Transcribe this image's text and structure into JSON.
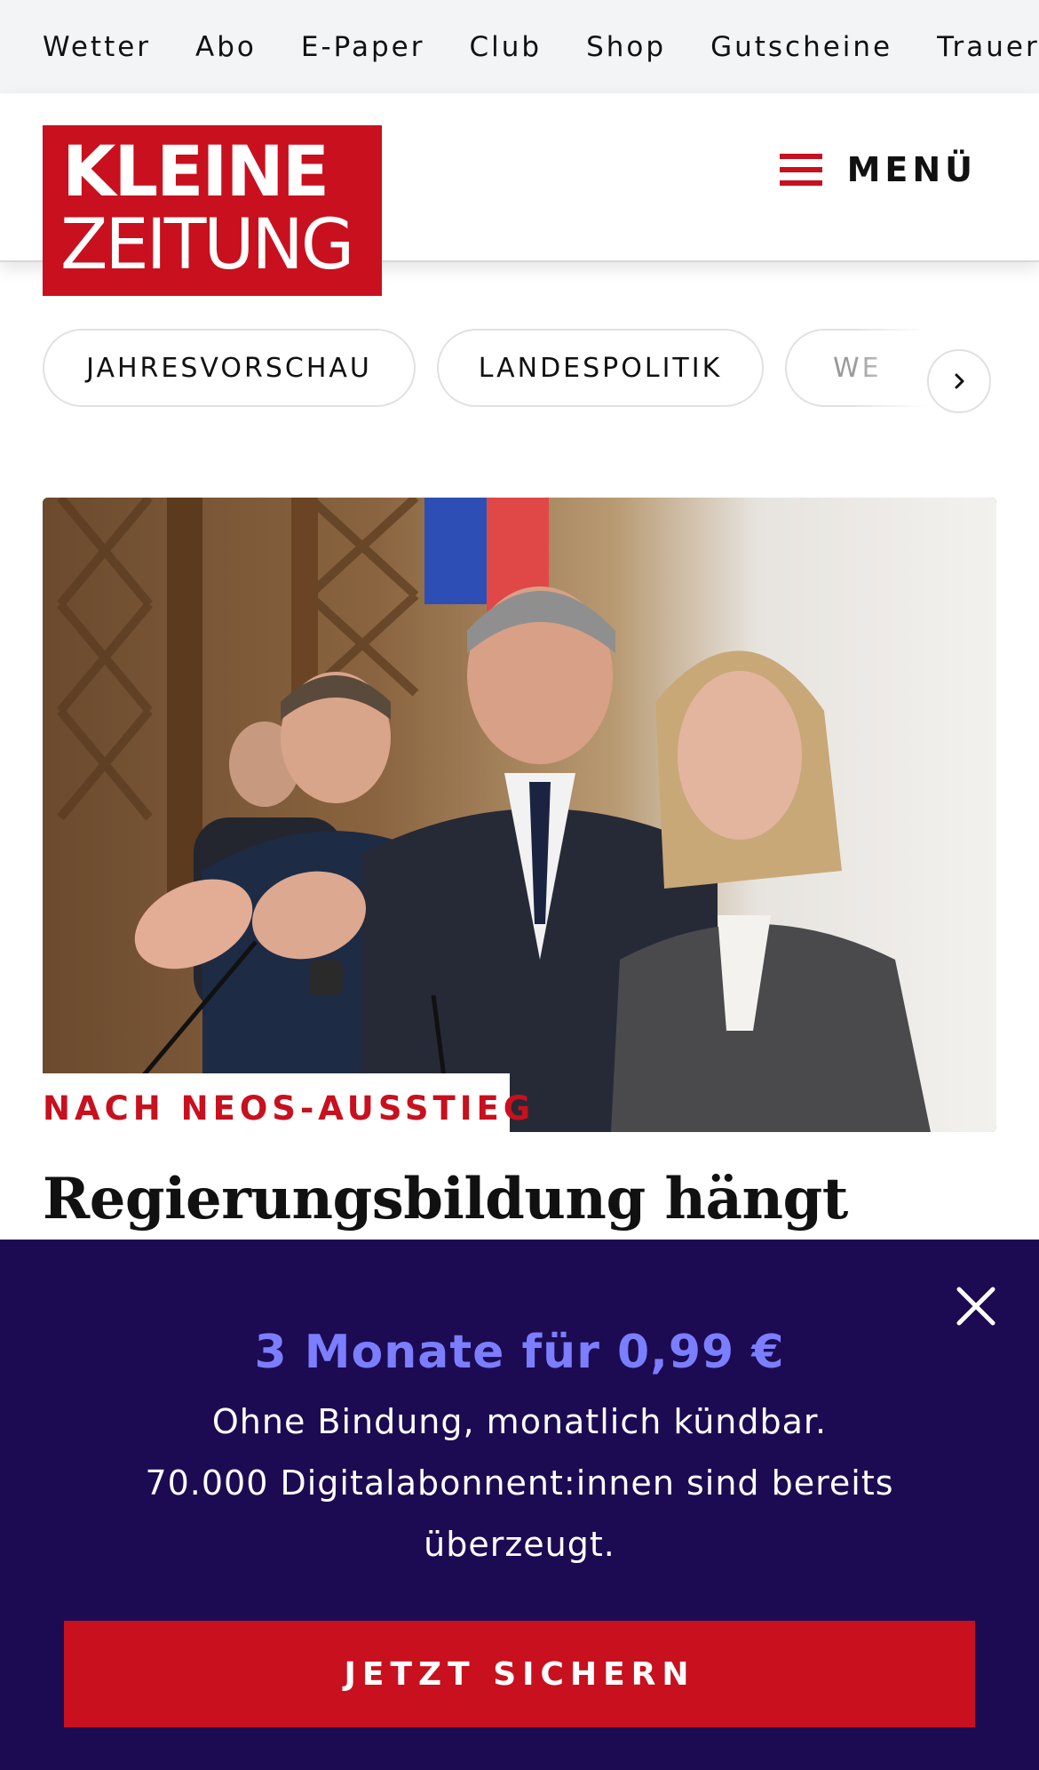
{
  "topbar": {
    "links": [
      "Wetter",
      "Abo",
      "E-Paper",
      "Club",
      "Shop",
      "Gutscheine",
      "Trauerp"
    ]
  },
  "header": {
    "logo_line1": "KLEINE",
    "logo_line2": "ZEITUNG",
    "menu_label": "MENÜ"
  },
  "topics": {
    "pills": [
      "JAHRESVORSCHAU",
      "LANDESPOLITIK",
      "WE"
    ]
  },
  "article": {
    "kicker": "NACH NEOS-AUSSTIEG",
    "headline": "Regierungsbildung hängt"
  },
  "promo": {
    "title": "3 Monate für 0,99 €",
    "line1": "Ohne Bindung, monatlich kündbar.",
    "line2": "70.000 Digitalabonnent:innen sind bereits",
    "line3": "überzeugt.",
    "cta_label": "JETZT SICHERN"
  },
  "colors": {
    "brand_red": "#c8101e",
    "promo_bg": "#1c0b52",
    "promo_title": "#7b7eff"
  }
}
